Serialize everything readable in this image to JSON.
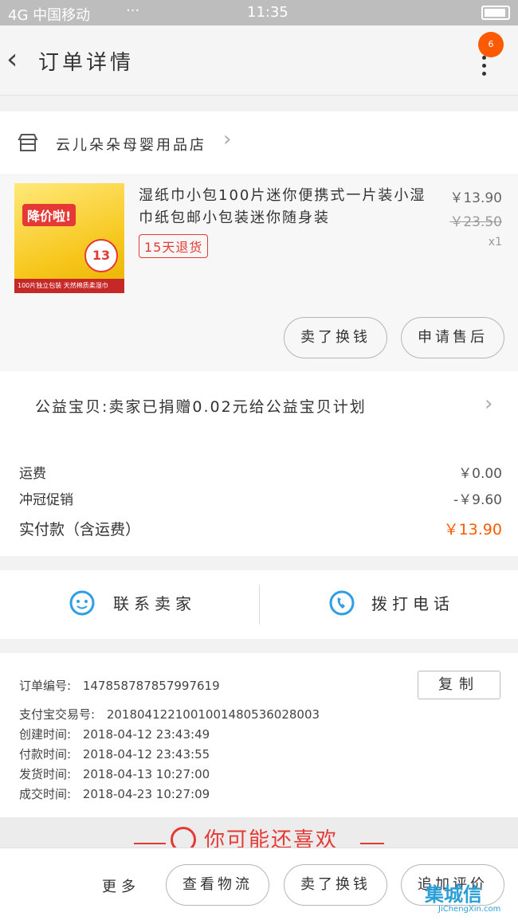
{
  "status_bar": {
    "carrier": "4G 中国移动",
    "dots": "···",
    "time": "11:35"
  },
  "header": {
    "back_icon": "‹",
    "title": "订单详情",
    "badge_count": "6"
  },
  "shop": {
    "name": "云儿朵朵母婴用品店",
    "chevron": "›"
  },
  "product": {
    "title": "湿纸巾小包100片迷你便携式一片装小湿巾纸包邮小包装迷你随身装",
    "return_policy": "15天退货",
    "price": "￥13.90",
    "original_price": "￥23.50",
    "quantity": "x1",
    "thumb_sale": "降价啦!",
    "thumb_price": "13",
    "thumb_bottom": "100片独立包装  天然棉质柔湿巾",
    "buttons": {
      "buy_again": "卖了换钱",
      "after_sale": "申请售后"
    }
  },
  "charity": {
    "text": "公益宝贝:卖家已捐赠0.02元给公益宝贝计划",
    "chevron": "›"
  },
  "fees": [
    {
      "label": "运费",
      "value": "￥0.00"
    },
    {
      "label": "冲冠促销",
      "value": "-￥9.60"
    },
    {
      "label": "实付款（含运费）",
      "value": "￥13.90",
      "accent": true
    }
  ],
  "contact": {
    "seller": "联系卖家",
    "call": "拨打电话"
  },
  "order_info": {
    "copy_label": "复制",
    "rows": [
      {
        "label": "订单编号:",
        "value": "147858787857997619"
      },
      {
        "label": "支付宝交易号:",
        "value": "2018041221001001480536028003"
      },
      {
        "label": "创建时间:",
        "value": "2018-04-12 23:43:49"
      },
      {
        "label": "付款时间:",
        "value": "2018-04-12 23:43:55"
      },
      {
        "label": "发货时间:",
        "value": "2018-04-13 10:27:00"
      },
      {
        "label": "成交时间:",
        "value": "2018-04-23 10:27:09"
      }
    ]
  },
  "recommend": {
    "title": "你可能还喜欢"
  },
  "bottom_bar": {
    "more": "更多",
    "logistics": "查看物流",
    "buy_again": "卖了换钱",
    "review": "追加评价"
  },
  "watermark": {
    "brand": "集城信",
    "url": "JiChengXin.com"
  },
  "colors": {
    "accent": "#ff5a00",
    "red": "#e53935",
    "blue": "#2f9ee6"
  }
}
